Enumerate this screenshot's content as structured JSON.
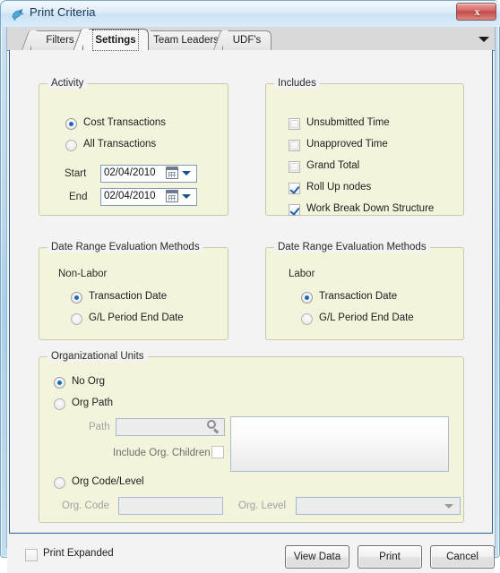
{
  "window": {
    "title": "Print Criteria",
    "icon": "bird-icon",
    "close_label": "x",
    "close_icon": "close-icon"
  },
  "tabs": {
    "items": [
      {
        "label": "Filters",
        "active": false
      },
      {
        "label": "Settings",
        "active": true
      },
      {
        "label": "Team Leaders",
        "active": false
      },
      {
        "label": "UDF's",
        "active": false
      }
    ],
    "overflow_icon": "chevron-down-icon"
  },
  "activity": {
    "title": "Activity",
    "radios": [
      {
        "label": "Cost Transactions",
        "selected": true
      },
      {
        "label": "All Transactions",
        "selected": false
      }
    ],
    "start_label": "Start",
    "start_value": "02/04/2010",
    "end_label": "End",
    "end_value": "02/04/2010",
    "calendar_icon": "calendar-icon",
    "dropdown_icon": "chevron-down-icon"
  },
  "includes": {
    "title": "Includes",
    "checkboxes": [
      {
        "label": "Unsubmitted Time",
        "checked": false
      },
      {
        "label": "Unapproved Time",
        "checked": false
      },
      {
        "label": "Grand Total",
        "checked": false
      },
      {
        "label": "Roll Up nodes",
        "checked": true
      },
      {
        "label": "Work Break Down Structure",
        "checked": true
      }
    ]
  },
  "nonlabor": {
    "title": "Date Range Evaluation Methods",
    "subtitle": "Non-Labor",
    "radios": [
      {
        "label": "Transaction Date",
        "selected": true
      },
      {
        "label": "G/L Period End Date",
        "selected": false
      }
    ]
  },
  "labor": {
    "title": "Date Range Evaluation Methods",
    "subtitle": "Labor",
    "radios": [
      {
        "label": "Transaction Date",
        "selected": true
      },
      {
        "label": "G/L Period End Date",
        "selected": false
      }
    ]
  },
  "org_units": {
    "title": "Organizational Units",
    "radios": [
      {
        "label": "No Org",
        "selected": true
      },
      {
        "label": "Org Path",
        "selected": false
      },
      {
        "label": "Org Code/Level",
        "selected": false
      }
    ],
    "path_label": "Path",
    "path_value": "",
    "path_placeholder": "",
    "search_icon": "magnifier-icon",
    "include_children_label": "Include Org. Children",
    "include_children_checked": false,
    "org_code_label": "Org. Code",
    "org_code_value": "",
    "org_level_label": "Org. Level",
    "org_level_value": "",
    "org_level_icon": "chevron-down-icon"
  },
  "footer": {
    "print_expanded_label": "Print Expanded",
    "print_expanded_checked": false,
    "view_data_label": "View Data",
    "print_label": "Print",
    "cancel_label": "Cancel"
  },
  "colors": {
    "group_background": "#F4F4DC",
    "panel_background": "#F3F3F3",
    "accent_blue": "#1769C0",
    "title_text": "#11354F",
    "close_red": "#C44B47"
  }
}
